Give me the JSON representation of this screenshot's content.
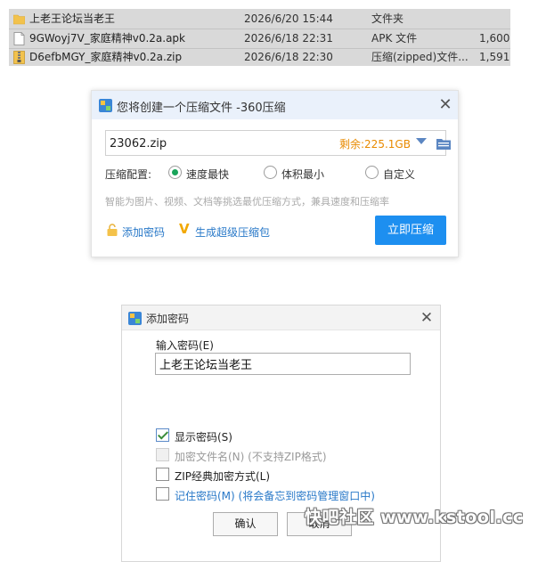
{
  "files": [
    {
      "name": "上老王论坛当老王",
      "date": "2026/6/20 15:44",
      "type": "文件夹",
      "size": "",
      "icon": "folder-icon"
    },
    {
      "name": "9GWoyj7V_家庭精神v0.2a.apk",
      "date": "2026/6/18 22:31",
      "type": "APK 文件",
      "size": "1,600,",
      "icon": "file-icon"
    },
    {
      "name": "D6efbMGY_家庭精神v0.2a.zip",
      "date": "2026/6/18 22:30",
      "type": "压缩(zipped)文件...",
      "size": "1,591,",
      "icon": "zip-file-icon"
    }
  ],
  "compress_dialog": {
    "title": "您将创建一个压缩文件 -360压缩",
    "filename": "23062.zip",
    "free_space": "剩余:225.1GB",
    "config_label": "压缩配置:",
    "options": [
      "速度最快",
      "体积最小",
      "自定义"
    ],
    "selected_option": "速度最快",
    "hint": "智能为图片、视频、文档等挑选最优压缩方式，兼具速度和压缩率",
    "add_password": "添加密码",
    "super_zip": "生成超级压缩包",
    "compress_button": "立即压缩",
    "close": "✕"
  },
  "password_dialog": {
    "title": "添加密码",
    "input_label": "输入密码(E)",
    "password_value": "上老王论坛当老王",
    "show_password": "显示密码(S)",
    "encrypt_filename": "加密文件名(N) (不支持ZIP格式)",
    "zip_classic": "ZIP经典加密方式(L)",
    "remember_password": "记住密码(M) (将会备忘到密码管理窗口中)",
    "ok_button": "确认",
    "cancel_button": "取消",
    "close": "✕"
  },
  "watermark": "快吧社区 www.kstool.cc",
  "colors": {
    "accent": "#1d8ff0",
    "link": "#2878c8",
    "free_space": "#e88a00",
    "radio_selected": "#19a45a"
  }
}
